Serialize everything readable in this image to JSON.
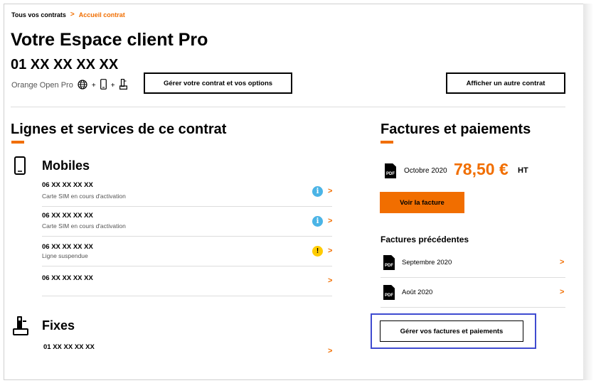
{
  "breadcrumb": {
    "parent": "Tous vos contrats",
    "separator": ">",
    "current": "Accueil contrat"
  },
  "header": {
    "title": "Votre Espace client Pro",
    "number": "01 XX XX XX XX",
    "offer": "Orange Open Pro",
    "plus": "+",
    "manage_button": "Gérer votre contrat et vos options",
    "other_contract_button": "Afficher un autre contrat"
  },
  "lines": {
    "title": "Lignes et services de ce contrat",
    "mobiles": {
      "heading": "Mobiles",
      "items": [
        {
          "number": "06 XX XX XX XX",
          "status": "Carte SIM en cours d'activation",
          "badge": "i"
        },
        {
          "number": "06 XX XX XX XX",
          "status": "Carte SIM en cours d'activation",
          "badge": "i"
        },
        {
          "number": "06 XX XX XX XX",
          "status": "Ligne suspendue",
          "badge": "!"
        },
        {
          "number": "06 XX XX XX XX",
          "status": "",
          "badge": ""
        }
      ]
    },
    "fixes": {
      "heading": "Fixes",
      "items": [
        {
          "number": "01 XX XX XX XX"
        }
      ]
    }
  },
  "bills": {
    "title": "Factures et paiements",
    "current": {
      "pdf": "PDF",
      "month": "Octobre 2020",
      "amount": "78,50 €",
      "tax": "HT"
    },
    "view_button": "Voir la facture",
    "previous_title": "Factures précédentes",
    "previous": [
      {
        "pdf": "PDF",
        "month": "Septembre 2020"
      },
      {
        "pdf": "PDF",
        "month": "Août 2020"
      }
    ],
    "manage_button": "Gérer vos factures et paiements"
  },
  "chevron": ">",
  "colors": {
    "accent": "#f16e00",
    "info": "#4bb4e6",
    "warning": "#ffcc00",
    "highlight": "#3f4bd0"
  },
  "icons": [
    "globe-icon",
    "mobile-icon",
    "fixed-phone-icon",
    "chevron-right-icon",
    "info-icon",
    "warning-icon",
    "pdf-icon"
  ]
}
